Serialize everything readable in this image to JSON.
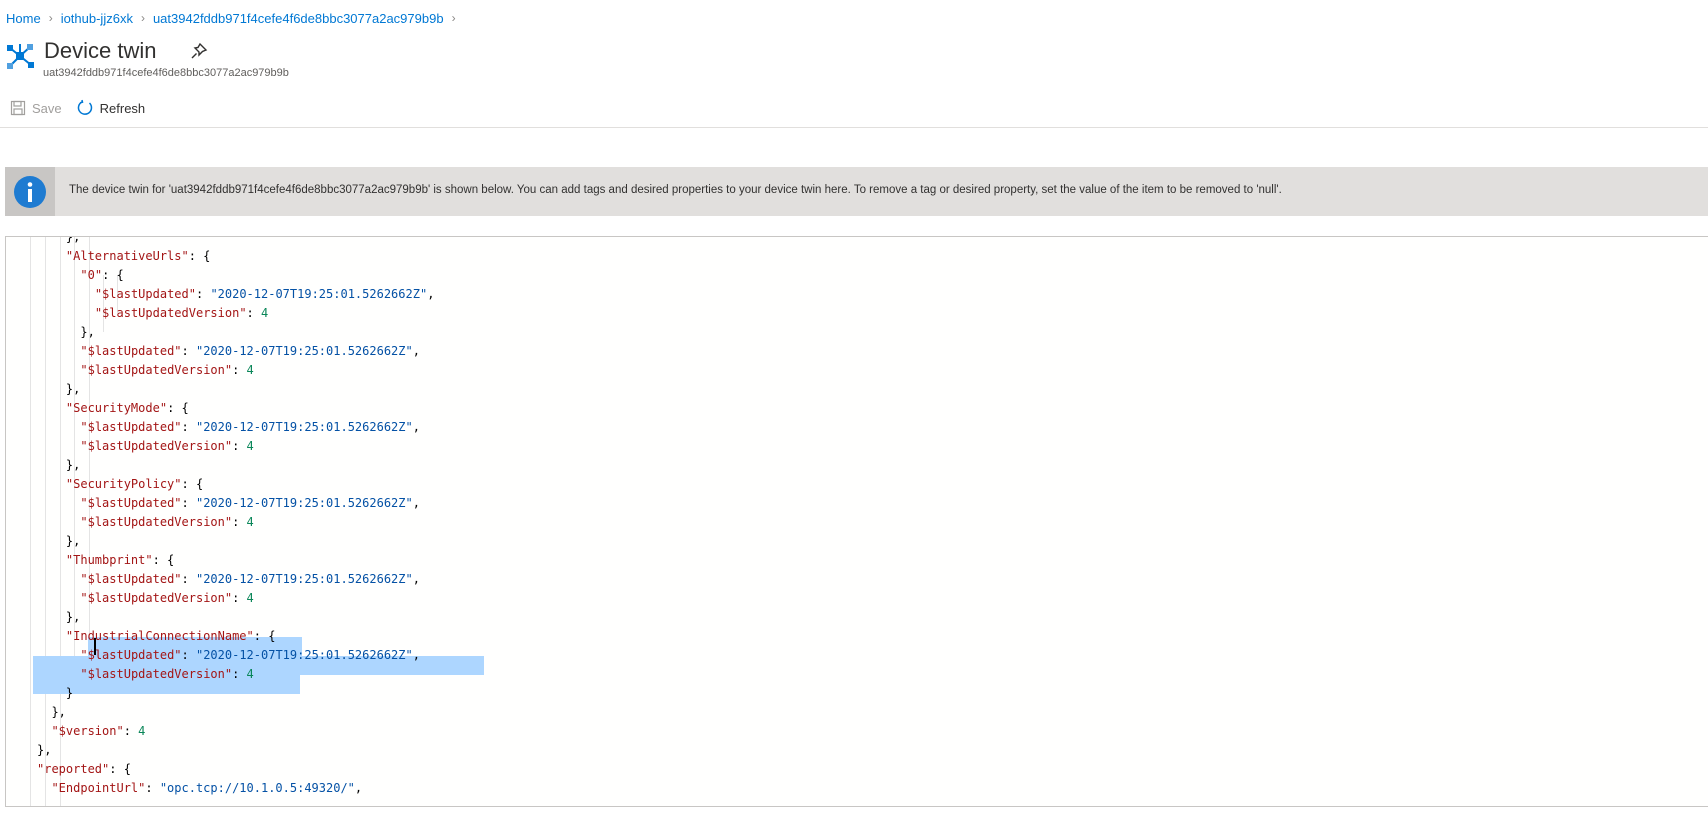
{
  "breadcrumb": {
    "items": [
      "Home",
      "iothub-jjz6xk",
      "uat3942fddb971f4cefe4f6de8bbc3077a2ac979b9b"
    ]
  },
  "header": {
    "title": "Device twin",
    "subtitle": "uat3942fddb971f4cefe4f6de8bbc3077a2ac979b9b"
  },
  "toolbar": {
    "save_label": "Save",
    "refresh_label": "Refresh"
  },
  "info_banner": {
    "text": "The device twin for 'uat3942fddb971f4cefe4f6de8bbc3077a2ac979b9b' is shown below. You can add tags and desired properties to your device twin here. To remove a tag or desired property, set the value of the item to be removed to 'null'."
  },
  "editor": {
    "lines": [
      {
        "indent": 6,
        "tokens": [
          {
            "t": "},",
            "c": "pun"
          }
        ]
      },
      {
        "indent": 6,
        "tokens": [
          {
            "t": "\"AlternativeUrls\"",
            "c": "key"
          },
          {
            "t": ": {",
            "c": "pun"
          }
        ]
      },
      {
        "indent": 8,
        "tokens": [
          {
            "t": "\"0\"",
            "c": "key"
          },
          {
            "t": ": {",
            "c": "pun"
          }
        ]
      },
      {
        "indent": 10,
        "tokens": [
          {
            "t": "\"$lastUpdated\"",
            "c": "key"
          },
          {
            "t": ": ",
            "c": "pun"
          },
          {
            "t": "\"2020-12-07T19:25:01.5262662Z\"",
            "c": "str"
          },
          {
            "t": ",",
            "c": "pun"
          }
        ]
      },
      {
        "indent": 10,
        "tokens": [
          {
            "t": "\"$lastUpdatedVersion\"",
            "c": "key"
          },
          {
            "t": ": ",
            "c": "pun"
          },
          {
            "t": "4",
            "c": "num"
          }
        ]
      },
      {
        "indent": 8,
        "tokens": [
          {
            "t": "},",
            "c": "pun"
          }
        ]
      },
      {
        "indent": 8,
        "tokens": [
          {
            "t": "\"$lastUpdated\"",
            "c": "key"
          },
          {
            "t": ": ",
            "c": "pun"
          },
          {
            "t": "\"2020-12-07T19:25:01.5262662Z\"",
            "c": "str"
          },
          {
            "t": ",",
            "c": "pun"
          }
        ]
      },
      {
        "indent": 8,
        "tokens": [
          {
            "t": "\"$lastUpdatedVersion\"",
            "c": "key"
          },
          {
            "t": ": ",
            "c": "pun"
          },
          {
            "t": "4",
            "c": "num"
          }
        ]
      },
      {
        "indent": 6,
        "tokens": [
          {
            "t": "},",
            "c": "pun"
          }
        ]
      },
      {
        "indent": 6,
        "tokens": [
          {
            "t": "\"SecurityMode\"",
            "c": "key"
          },
          {
            "t": ": {",
            "c": "pun"
          }
        ]
      },
      {
        "indent": 8,
        "tokens": [
          {
            "t": "\"$lastUpdated\"",
            "c": "key"
          },
          {
            "t": ": ",
            "c": "pun"
          },
          {
            "t": "\"2020-12-07T19:25:01.5262662Z\"",
            "c": "str"
          },
          {
            "t": ",",
            "c": "pun"
          }
        ]
      },
      {
        "indent": 8,
        "tokens": [
          {
            "t": "\"$lastUpdatedVersion\"",
            "c": "key"
          },
          {
            "t": ": ",
            "c": "pun"
          },
          {
            "t": "4",
            "c": "num"
          }
        ]
      },
      {
        "indent": 6,
        "tokens": [
          {
            "t": "},",
            "c": "pun"
          }
        ]
      },
      {
        "indent": 6,
        "tokens": [
          {
            "t": "\"SecurityPolicy\"",
            "c": "key"
          },
          {
            "t": ": {",
            "c": "pun"
          }
        ]
      },
      {
        "indent": 8,
        "tokens": [
          {
            "t": "\"$lastUpdated\"",
            "c": "key"
          },
          {
            "t": ": ",
            "c": "pun"
          },
          {
            "t": "\"2020-12-07T19:25:01.5262662Z\"",
            "c": "str"
          },
          {
            "t": ",",
            "c": "pun"
          }
        ]
      },
      {
        "indent": 8,
        "tokens": [
          {
            "t": "\"$lastUpdatedVersion\"",
            "c": "key"
          },
          {
            "t": ": ",
            "c": "pun"
          },
          {
            "t": "4",
            "c": "num"
          }
        ]
      },
      {
        "indent": 6,
        "tokens": [
          {
            "t": "},",
            "c": "pun"
          }
        ]
      },
      {
        "indent": 6,
        "tokens": [
          {
            "t": "\"Thumbprint\"",
            "c": "key"
          },
          {
            "t": ": {",
            "c": "pun"
          }
        ]
      },
      {
        "indent": 8,
        "tokens": [
          {
            "t": "\"$lastUpdated\"",
            "c": "key"
          },
          {
            "t": ": ",
            "c": "pun"
          },
          {
            "t": "\"2020-12-07T19:25:01.5262662Z\"",
            "c": "str"
          },
          {
            "t": ",",
            "c": "pun"
          }
        ]
      },
      {
        "indent": 8,
        "tokens": [
          {
            "t": "\"$lastUpdatedVersion\"",
            "c": "key"
          },
          {
            "t": ": ",
            "c": "pun"
          },
          {
            "t": "4",
            "c": "num"
          }
        ]
      },
      {
        "indent": 6,
        "tokens": [
          {
            "t": "},",
            "c": "pun"
          }
        ]
      },
      {
        "indent": 6,
        "tokens": [
          {
            "t": "\"IndustrialConnectionName\"",
            "c": "key"
          },
          {
            "t": ": {",
            "c": "pun"
          }
        ]
      },
      {
        "indent": 8,
        "tokens": [
          {
            "t": "\"$lastUpdated\"",
            "c": "key"
          },
          {
            "t": ": ",
            "c": "pun"
          },
          {
            "t": "\"2020-12-07T19:25:01.5262662Z\"",
            "c": "str"
          },
          {
            "t": ",",
            "c": "pun"
          }
        ]
      },
      {
        "indent": 8,
        "tokens": [
          {
            "t": "\"$lastUpdatedVersion\"",
            "c": "key"
          },
          {
            "t": ": ",
            "c": "pun"
          },
          {
            "t": "4",
            "c": "num"
          }
        ]
      },
      {
        "indent": 6,
        "tokens": [
          {
            "t": "}",
            "c": "pun"
          }
        ]
      },
      {
        "indent": 4,
        "tokens": [
          {
            "t": "},",
            "c": "pun"
          }
        ]
      },
      {
        "indent": 4,
        "tokens": [
          {
            "t": "\"$version\"",
            "c": "key"
          },
          {
            "t": ": ",
            "c": "pun"
          },
          {
            "t": "4",
            "c": "num"
          }
        ]
      },
      {
        "indent": 2,
        "tokens": [
          {
            "t": "},",
            "c": "pun"
          }
        ]
      },
      {
        "indent": 2,
        "tokens": [
          {
            "t": "\"reported\"",
            "c": "key"
          },
          {
            "t": ": {",
            "c": "pun"
          }
        ]
      },
      {
        "indent": 4,
        "tokens": [
          {
            "t": "\"EndpointUrl\"",
            "c": "key"
          },
          {
            "t": ": ",
            "c": "pun"
          },
          {
            "t": "\"opc.tcp://10.1.0.5:49320/\"",
            "c": "str"
          },
          {
            "t": ",",
            "c": "pun"
          }
        ]
      }
    ]
  },
  "colors": {
    "accent": "#0078d4",
    "json_key": "#a31515",
    "json_string": "#0451a5",
    "json_number": "#098658",
    "selection": "#add6ff"
  }
}
